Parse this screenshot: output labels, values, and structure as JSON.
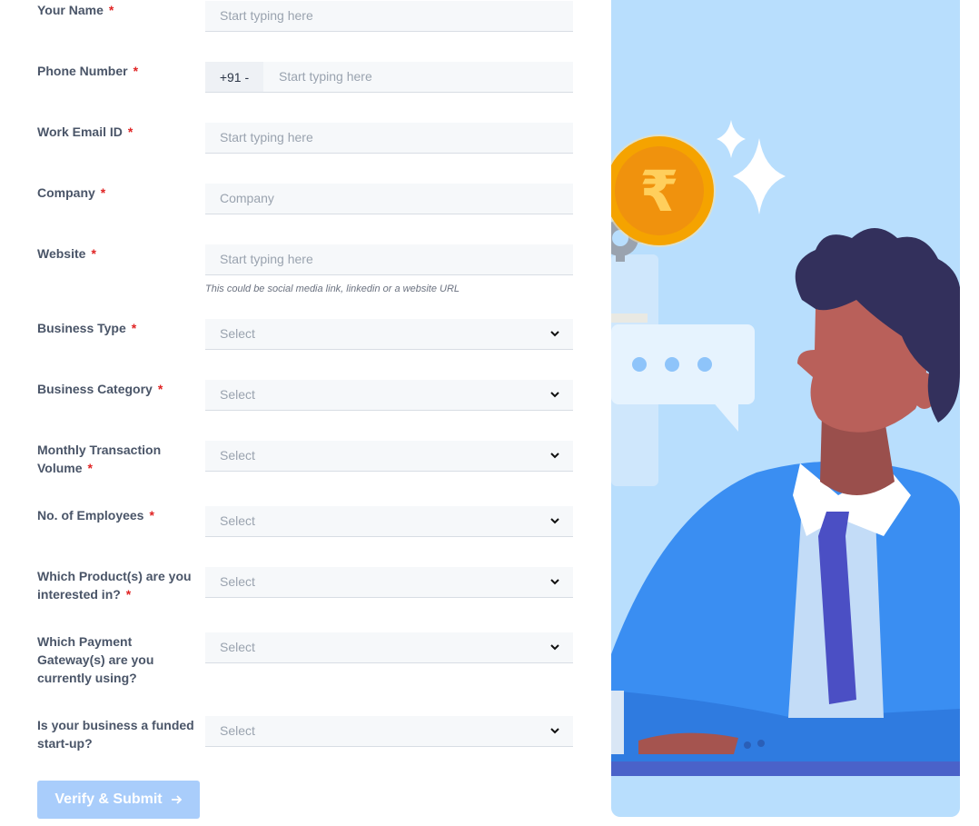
{
  "form": {
    "fields": [
      {
        "label": "Your Name",
        "required": "*",
        "placeholder": "Start typing here"
      },
      {
        "label": "Phone Number",
        "required": "*",
        "prefix": "+91 -",
        "placeholder": "Start typing here"
      },
      {
        "label": "Work Email ID",
        "required": "*",
        "placeholder": "Start typing here"
      },
      {
        "label": "Company",
        "required": "*",
        "placeholder": "Company"
      },
      {
        "label": "Website",
        "required": "*",
        "placeholder": "Start typing here",
        "hint": "This could be social media link, linkedin or a website URL"
      },
      {
        "label": "Business Type",
        "required": "*",
        "value": "Select"
      },
      {
        "label": "Business Category",
        "required": "*",
        "value": "Select"
      },
      {
        "label": "Monthly Transaction Volume",
        "required": "*",
        "value": "Select"
      },
      {
        "label": "No. of Employees",
        "required": "*",
        "value": "Select"
      },
      {
        "label": "Which Product(s) are you interested in?",
        "required": "*",
        "value": "Select"
      },
      {
        "label": "Which Payment Gateway(s) are you currently using?",
        "value": "Select"
      },
      {
        "label": "Is your business a funded start-up?",
        "value": "Select"
      }
    ],
    "submit_label": "Verify & Submit",
    "submit_icon": "arrow-right-icon"
  },
  "illustration": {
    "coin_symbol": "₹",
    "colors": {
      "panel": "#b8defd",
      "coin": "#f5a300",
      "suit": "#3a8ef2",
      "tie": "#4b4fc4",
      "hair": "#33305c",
      "skin": "#b9605a"
    }
  }
}
